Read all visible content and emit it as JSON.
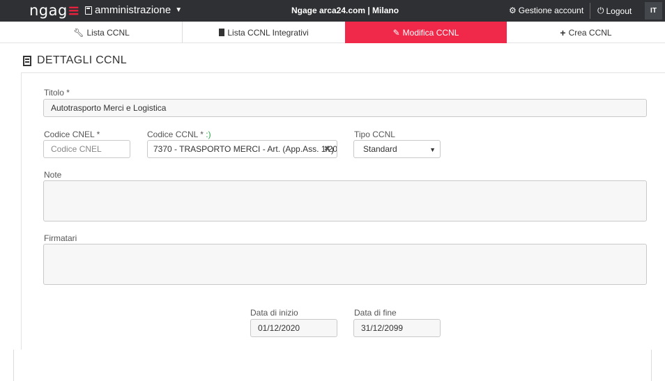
{
  "topbar": {
    "logo_main": "ngag",
    "logo_accent": "≡",
    "section": "amministrazione",
    "site": "Ngage arca24.com | Milano",
    "account": "Gestione account",
    "logout": "Logout",
    "lang": "IT"
  },
  "tabs": [
    {
      "label": "Lista CCNL",
      "icon": "wrench-icon"
    },
    {
      "label": "Lista CCNL Integrativi",
      "icon": "building-icon"
    },
    {
      "label": "Modifica CCNL",
      "icon": "pencil-icon",
      "active": true
    },
    {
      "label": "Crea CCNL",
      "icon": "plus-icon"
    }
  ],
  "page": {
    "title": "DETTAGLI CCNL"
  },
  "form": {
    "titolo_label": "Titolo *",
    "titolo_value": "Autotrasporto Merci e Logistica",
    "cnel_label": "Codice CNEL *",
    "cnel_placeholder": "Codice CNEL",
    "ccnl_label": "Codice CCNL *",
    "ccnl_smiley": ":)",
    "ccnl_value": "7370 - TRASPORTO MERCI - Art. (App.Ass. 1/20",
    "ccnl_tail": ")",
    "tipo_label": "Tipo CCNL",
    "tipo_value": "Standard",
    "note_label": "Note",
    "firmatari_label": "Firmatari",
    "data_inizio_label": "Data di inizio",
    "data_inizio_value": "01/12/2020",
    "data_fine_label": "Data di fine",
    "data_fine_value": "31/12/2099"
  },
  "colors": {
    "accent": "#f0284a",
    "topbar": "#2e3033"
  }
}
